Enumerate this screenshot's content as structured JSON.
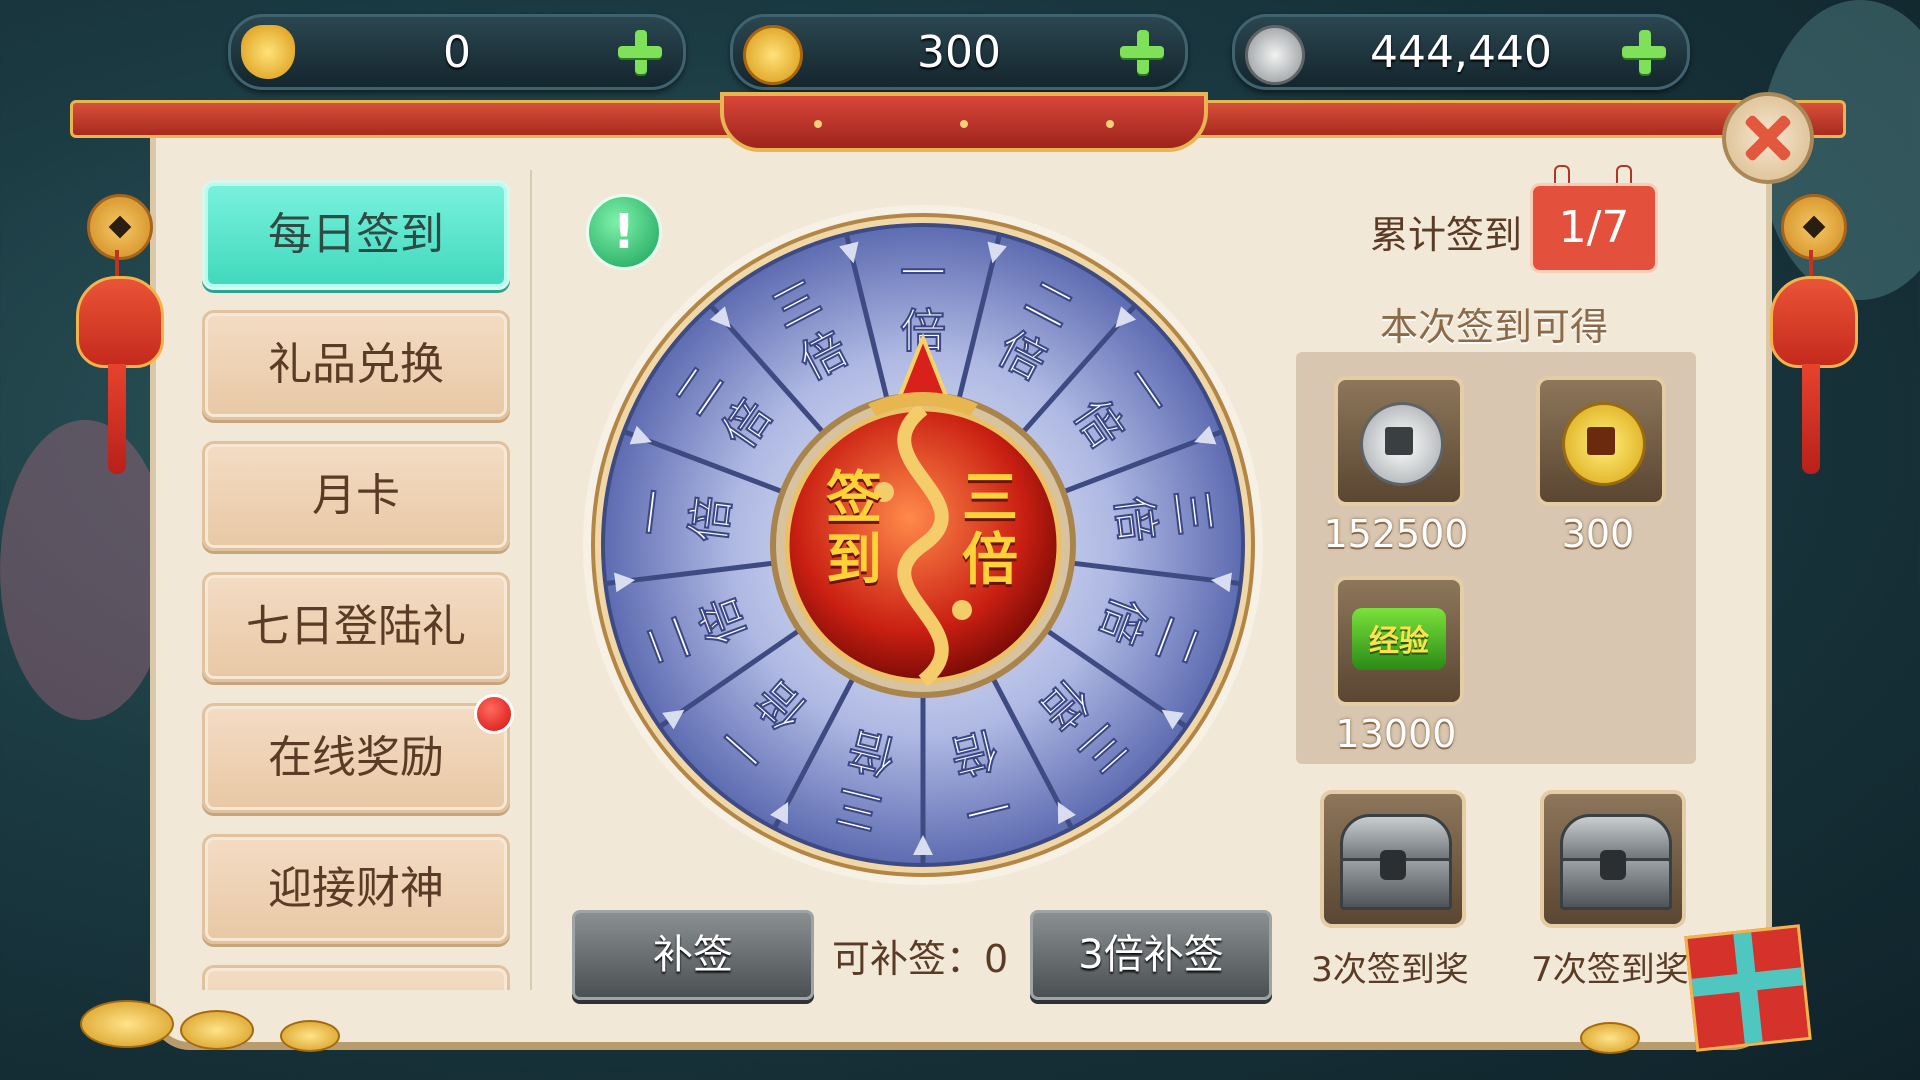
{
  "currency": {
    "ingot": {
      "value": "0",
      "icon": "gold-ingot-icon"
    },
    "gold_coin": {
      "value": "300",
      "icon": "gold-coin-icon"
    },
    "silver_coin": {
      "value": "444,440",
      "icon": "silver-coin-icon"
    }
  },
  "sidebar": {
    "items": [
      {
        "label": "每日签到",
        "active": true
      },
      {
        "label": "礼品兑换"
      },
      {
        "label": "月卡"
      },
      {
        "label": "七日登陆礼"
      },
      {
        "label": "在线奖励"
      },
      {
        "label": "迎接财神"
      }
    ]
  },
  "wheel": {
    "center_left": "签到",
    "center_right": "三倍",
    "segments": [
      "一倍",
      "二倍",
      "一倍",
      "三倍",
      "二倍",
      "三倍",
      "一倍",
      "三倍",
      "一倍",
      "二倍",
      "一倍",
      "二倍",
      "三倍"
    ]
  },
  "actions": {
    "bu_qian": "补签",
    "bu_qian_count": "可补签：0",
    "triple_bu_qian": "3倍补签"
  },
  "cumulative": {
    "label": "累计签到",
    "value": "1/7"
  },
  "rewards": {
    "title": "本次签到可得",
    "items": [
      {
        "icon": "silver-coin-icon",
        "qty": "152500"
      },
      {
        "icon": "gold-coin-icon",
        "qty": "300"
      },
      {
        "icon": "experience-icon",
        "qty": "13000",
        "label": "经验"
      }
    ]
  },
  "chests": [
    {
      "label": "3次签到奖",
      "icon": "treasure-chest-icon"
    },
    {
      "label": "7次签到奖",
      "icon": "treasure-chest-icon"
    }
  ],
  "colors": {
    "accent_teal": "#3fd8bd",
    "panel": "#f1e8d8",
    "frame_red": "#c42a1d"
  }
}
